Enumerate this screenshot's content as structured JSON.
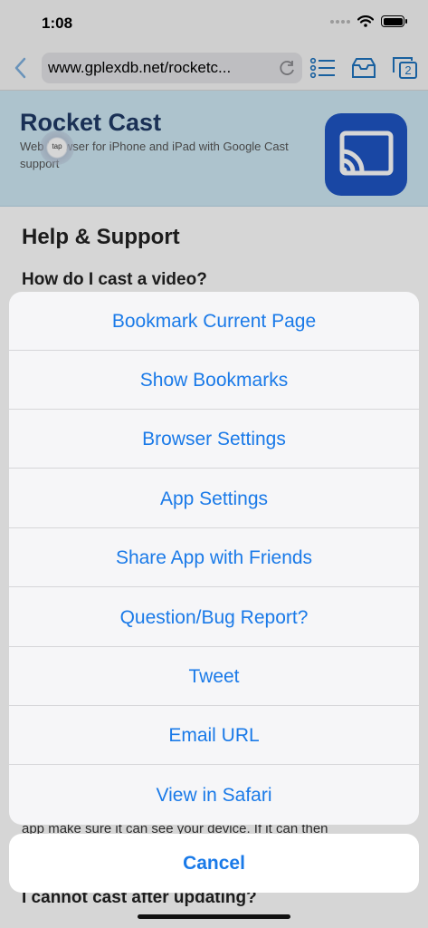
{
  "status_bar": {
    "time": "1:08"
  },
  "toolbar": {
    "url": "www.gplexdb.net/rocketc...",
    "tabs_count": "2"
  },
  "page": {
    "hero_title": "Rocket Cast",
    "hero_desc": "Web browser for iPhone and iPad with Google Cast support",
    "tap_label": "tap",
    "help_heading": "Help & Support",
    "faq_q1": "How do I cast a video?",
    "body_text": "app make sure it can see your device. If it can then",
    "faq_q2": "I cannot cast after updating?"
  },
  "action_sheet": {
    "items": [
      "Bookmark Current Page",
      "Show Bookmarks",
      "Browser Settings",
      "App Settings",
      "Share App with Friends",
      "Question/Bug Report?",
      "Tweet",
      "Email URL",
      "View in Safari"
    ],
    "cancel": "Cancel"
  },
  "colors": {
    "accent": "#1a7ae8",
    "toolbar_icon": "#1e73be",
    "hero_bg": "#cfe9f5",
    "app_icon": "#1e55c4"
  }
}
